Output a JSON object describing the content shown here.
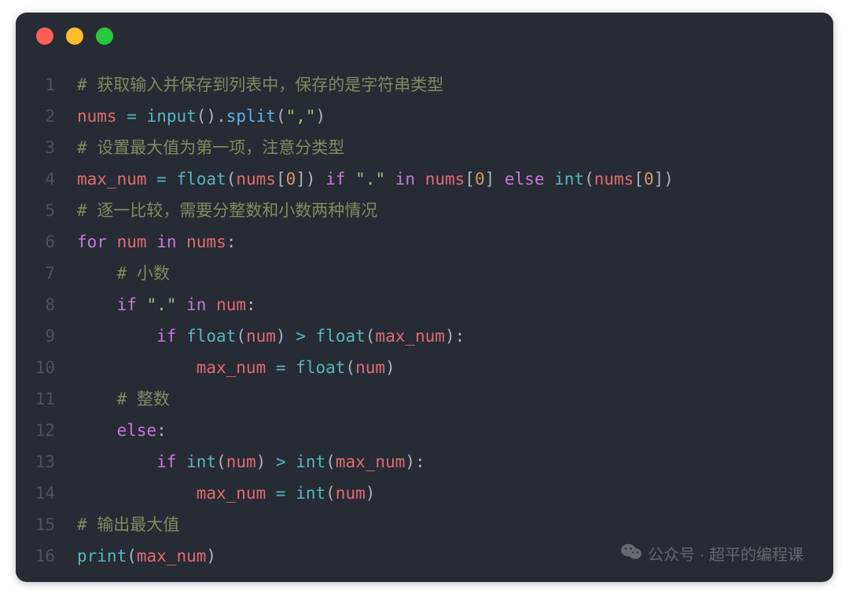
{
  "window": {
    "traffic_lights": [
      "close",
      "minimize",
      "zoom"
    ]
  },
  "code": {
    "language": "python",
    "lines": [
      {
        "n": 1,
        "tokens": [
          [
            "comment",
            "# 获取输入并保存到列表中，保存的是字符串类型"
          ]
        ]
      },
      {
        "n": 2,
        "tokens": [
          [
            "var",
            "nums"
          ],
          [
            "plain",
            " "
          ],
          [
            "op",
            "="
          ],
          [
            "plain",
            " "
          ],
          [
            "builtin",
            "input"
          ],
          [
            "paren",
            "()"
          ],
          [
            "punc",
            "."
          ],
          [
            "call",
            "split"
          ],
          [
            "paren",
            "("
          ],
          [
            "str",
            "\",\""
          ],
          [
            "paren",
            ")"
          ]
        ]
      },
      {
        "n": 3,
        "tokens": [
          [
            "comment",
            "# 设置最大值为第一项，注意分类型"
          ]
        ]
      },
      {
        "n": 4,
        "tokens": [
          [
            "var",
            "max_num"
          ],
          [
            "plain",
            " "
          ],
          [
            "op",
            "="
          ],
          [
            "plain",
            " "
          ],
          [
            "builtin",
            "float"
          ],
          [
            "paren",
            "("
          ],
          [
            "var",
            "nums"
          ],
          [
            "paren",
            "["
          ],
          [
            "num",
            "0"
          ],
          [
            "paren",
            "])"
          ],
          [
            "plain",
            " "
          ],
          [
            "kw",
            "if"
          ],
          [
            "plain",
            " "
          ],
          [
            "str",
            "\".\""
          ],
          [
            "plain",
            " "
          ],
          [
            "kw",
            "in"
          ],
          [
            "plain",
            " "
          ],
          [
            "var",
            "nums"
          ],
          [
            "paren",
            "["
          ],
          [
            "num",
            "0"
          ],
          [
            "paren",
            "]"
          ],
          [
            "plain",
            " "
          ],
          [
            "kw",
            "else"
          ],
          [
            "plain",
            " "
          ],
          [
            "builtin",
            "int"
          ],
          [
            "paren",
            "("
          ],
          [
            "var",
            "nums"
          ],
          [
            "paren",
            "["
          ],
          [
            "num",
            "0"
          ],
          [
            "paren",
            "])"
          ]
        ]
      },
      {
        "n": 5,
        "tokens": [
          [
            "comment",
            "# 逐一比较，需要分整数和小数两种情况"
          ]
        ]
      },
      {
        "n": 6,
        "tokens": [
          [
            "kw",
            "for"
          ],
          [
            "plain",
            " "
          ],
          [
            "var",
            "num"
          ],
          [
            "plain",
            " "
          ],
          [
            "kw",
            "in"
          ],
          [
            "plain",
            " "
          ],
          [
            "var",
            "nums"
          ],
          [
            "punc",
            ":"
          ]
        ]
      },
      {
        "n": 7,
        "indent": 1,
        "tokens": [
          [
            "comment",
            "# 小数"
          ]
        ]
      },
      {
        "n": 8,
        "indent": 1,
        "tokens": [
          [
            "kw",
            "if"
          ],
          [
            "plain",
            " "
          ],
          [
            "str",
            "\".\""
          ],
          [
            "plain",
            " "
          ],
          [
            "kw",
            "in"
          ],
          [
            "plain",
            " "
          ],
          [
            "var",
            "num"
          ],
          [
            "punc",
            ":"
          ]
        ]
      },
      {
        "n": 9,
        "indent": 2,
        "tokens": [
          [
            "kw",
            "if"
          ],
          [
            "plain",
            " "
          ],
          [
            "builtin",
            "float"
          ],
          [
            "paren",
            "("
          ],
          [
            "var",
            "num"
          ],
          [
            "paren",
            ")"
          ],
          [
            "plain",
            " "
          ],
          [
            "op",
            ">"
          ],
          [
            "plain",
            " "
          ],
          [
            "builtin",
            "float"
          ],
          [
            "paren",
            "("
          ],
          [
            "var",
            "max_num"
          ],
          [
            "paren",
            ")"
          ],
          [
            "punc",
            ":"
          ]
        ]
      },
      {
        "n": 10,
        "indent": 3,
        "tokens": [
          [
            "var",
            "max_num"
          ],
          [
            "plain",
            " "
          ],
          [
            "op",
            "="
          ],
          [
            "plain",
            " "
          ],
          [
            "builtin",
            "float"
          ],
          [
            "paren",
            "("
          ],
          [
            "var",
            "num"
          ],
          [
            "paren",
            ")"
          ]
        ]
      },
      {
        "n": 11,
        "indent": 1,
        "tokens": [
          [
            "comment",
            "# 整数"
          ]
        ]
      },
      {
        "n": 12,
        "indent": 1,
        "tokens": [
          [
            "kw",
            "else"
          ],
          [
            "punc",
            ":"
          ]
        ]
      },
      {
        "n": 13,
        "indent": 2,
        "tokens": [
          [
            "kw",
            "if"
          ],
          [
            "plain",
            " "
          ],
          [
            "builtin",
            "int"
          ],
          [
            "paren",
            "("
          ],
          [
            "var",
            "num"
          ],
          [
            "paren",
            ")"
          ],
          [
            "plain",
            " "
          ],
          [
            "op",
            ">"
          ],
          [
            "plain",
            " "
          ],
          [
            "builtin",
            "int"
          ],
          [
            "paren",
            "("
          ],
          [
            "var",
            "max_num"
          ],
          [
            "paren",
            ")"
          ],
          [
            "punc",
            ":"
          ]
        ]
      },
      {
        "n": 14,
        "indent": 3,
        "tokens": [
          [
            "var",
            "max_num"
          ],
          [
            "plain",
            " "
          ],
          [
            "op",
            "="
          ],
          [
            "plain",
            " "
          ],
          [
            "builtin",
            "int"
          ],
          [
            "paren",
            "("
          ],
          [
            "var",
            "num"
          ],
          [
            "paren",
            ")"
          ]
        ]
      },
      {
        "n": 15,
        "tokens": [
          [
            "comment",
            "# 输出最大值"
          ]
        ]
      },
      {
        "n": 16,
        "tokens": [
          [
            "builtin",
            "print"
          ],
          [
            "paren",
            "("
          ],
          [
            "var",
            "max_num"
          ],
          [
            "paren",
            ")"
          ]
        ]
      }
    ]
  },
  "watermark": {
    "text": "公众号 · 超平的编程课",
    "icon": "wechat-icon"
  }
}
